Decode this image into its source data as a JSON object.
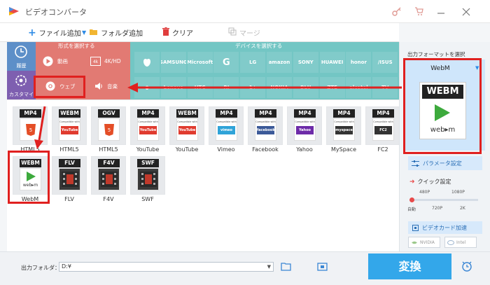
{
  "app": {
    "title": "ビデオコンバータ"
  },
  "toolbar": {
    "add_file": "ファイル追加",
    "add_folder": "フォルダ追加",
    "clear": "クリア",
    "merge": "マージ"
  },
  "format_bar": {
    "select_format_label": "形式を選択する",
    "select_device_label": "デバイスを選択する",
    "recent": "履歴",
    "custom": "カスタマイズ",
    "video": "動画",
    "hd": "4K/HD",
    "web": "ウェブ",
    "music": "音楽",
    "devices_row1": [
      "apple-logo",
      "SAMSUNG",
      "Microsoft",
      "G",
      "LG",
      "amazon",
      "SONY",
      "HUAWEI",
      "honor",
      "/ISUS"
    ],
    "devices_row2": [
      "●",
      "Lenovo",
      "HTC",
      "RI",
      "1+",
      "NOKIA",
      "BLU",
      "ZTE",
      "alcatel",
      "TV"
    ]
  },
  "formats": [
    {
      "badge": "MP4",
      "sub": "html5",
      "label": "HTML5"
    },
    {
      "badge": "WEBM",
      "sub": "youtube",
      "label": "HTML5"
    },
    {
      "badge": "OGV",
      "sub": "html5",
      "label": "HTML5"
    },
    {
      "badge": "MP4",
      "sub": "youtube",
      "label": "YouTube"
    },
    {
      "badge": "WEBM",
      "sub": "youtube",
      "label": "YouTube"
    },
    {
      "badge": "MP4",
      "sub": "vimeo",
      "label": "Vimeo"
    },
    {
      "badge": "MP4",
      "sub": "facebook",
      "label": "Facebook"
    },
    {
      "badge": "MP4",
      "sub": "yahoo",
      "label": "Yahoo"
    },
    {
      "badge": "MP4",
      "sub": "myspace",
      "label": "MySpace"
    },
    {
      "badge": "MP4",
      "sub": "fc2",
      "label": "FC2"
    },
    {
      "badge": "WEBM",
      "sub": "webm",
      "label": "WebM"
    },
    {
      "badge": "FLV",
      "sub": "film",
      "label": "FLV"
    },
    {
      "badge": "F4V",
      "sub": "film",
      "label": "F4V"
    },
    {
      "badge": "SWF",
      "sub": "film",
      "label": "SWF"
    }
  ],
  "compat_text": "Compatible with",
  "compat_names": {
    "youtube": "YouTube",
    "vimeo": "vimeo",
    "facebook": "facebook",
    "yahoo": "Yahoo",
    "myspace": "myspace",
    "fc2": "FC2",
    "webm": "web▸m"
  },
  "right_panel": {
    "output_format_label": "出力フォーマットを選択",
    "selected_format": "WebM",
    "big_badge": "WEBM",
    "big_sub": "web▸m",
    "param_settings": "パラメータ設定",
    "quick_settings": "クイック設定",
    "quality_top": [
      "480P",
      "1080P"
    ],
    "quality_bottom": [
      "自動",
      "720P",
      "2K"
    ],
    "gpu_accel": "ビデオカード加速",
    "nvidia": "NVIDIA",
    "intel": "Intel"
  },
  "bottom": {
    "output_folder_label": "出力フォルダ：",
    "output_folder_value": "D:¥",
    "convert": "変換"
  },
  "colors": {
    "accent": "#2ea4e8",
    "format_red": "#e27a73",
    "device_teal": "#73c6c4",
    "highlight_red": "#e0201f",
    "convert_blue": "#33a7ea"
  }
}
